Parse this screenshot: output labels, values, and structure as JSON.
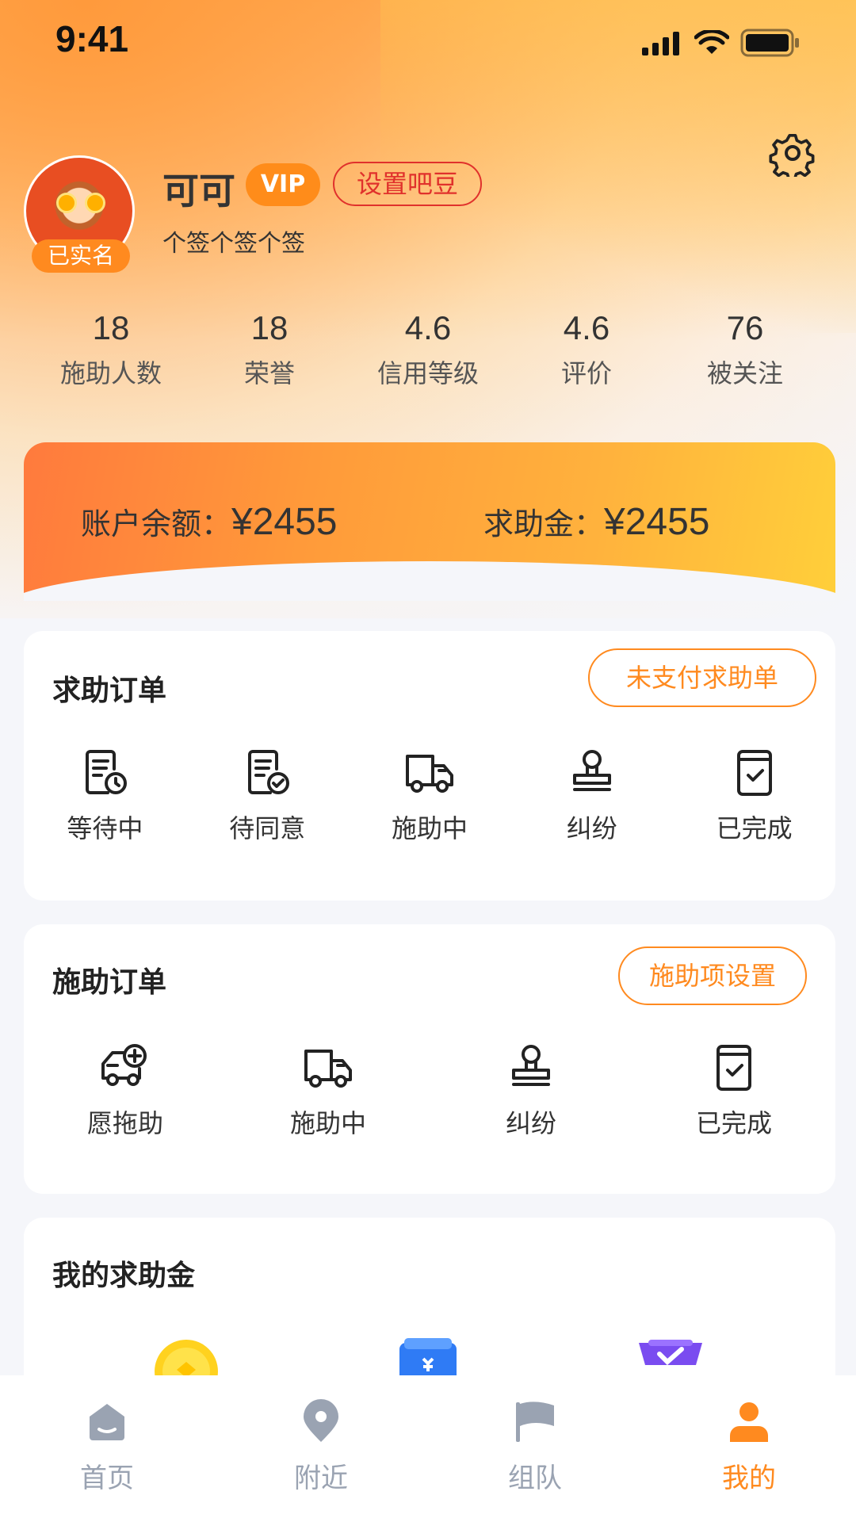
{
  "status_bar": {
    "time": "9:41"
  },
  "profile": {
    "name": "可可",
    "vip_label": "VIP",
    "set_bean_label": "设置吧豆",
    "signature": "个签个签个签",
    "verified_label": "已实名"
  },
  "stats": [
    {
      "value": "18",
      "label": "施助人数"
    },
    {
      "value": "18",
      "label": "荣誉"
    },
    {
      "value": "4.6",
      "label": "信用等级"
    },
    {
      "value": "4.6",
      "label": "评价"
    },
    {
      "value": "76",
      "label": "被关注"
    }
  ],
  "balance": {
    "account_label": "账户余额：",
    "account_amount": "¥2455",
    "help_label": "求助金：",
    "help_amount": "¥2455"
  },
  "help_orders": {
    "title": "求助订单",
    "action_label": "未支付求助单",
    "items": [
      {
        "label": "等待中",
        "icon": "doc-clock-icon"
      },
      {
        "label": "待同意",
        "icon": "doc-check-icon"
      },
      {
        "label": "施助中",
        "icon": "truck-icon"
      },
      {
        "label": "纠纷",
        "icon": "stamp-icon"
      },
      {
        "label": "已完成",
        "icon": "clipboard-check-icon"
      }
    ]
  },
  "assist_orders": {
    "title": "施助订单",
    "action_label": "施助项设置",
    "items": [
      {
        "label": "愿拖助",
        "icon": "truck-plus-icon"
      },
      {
        "label": "施助中",
        "icon": "truck-icon"
      },
      {
        "label": "纠纷",
        "icon": "stamp-icon"
      },
      {
        "label": "已完成",
        "icon": "clipboard-check-icon"
      }
    ]
  },
  "my_help_fund": {
    "title": "我的求助金"
  },
  "bottom_nav": [
    {
      "label": "首页",
      "icon": "home-icon",
      "active": false
    },
    {
      "label": "附近",
      "icon": "location-icon",
      "active": false
    },
    {
      "label": "组队",
      "icon": "flag-icon",
      "active": false
    },
    {
      "label": "我的",
      "icon": "user-icon",
      "active": true
    }
  ],
  "colors": {
    "accent": "#ff8a1f",
    "vip_bg": "#ff8c1a",
    "bean_red": "#e0312c",
    "nav_inactive": "#9aa3b2"
  }
}
